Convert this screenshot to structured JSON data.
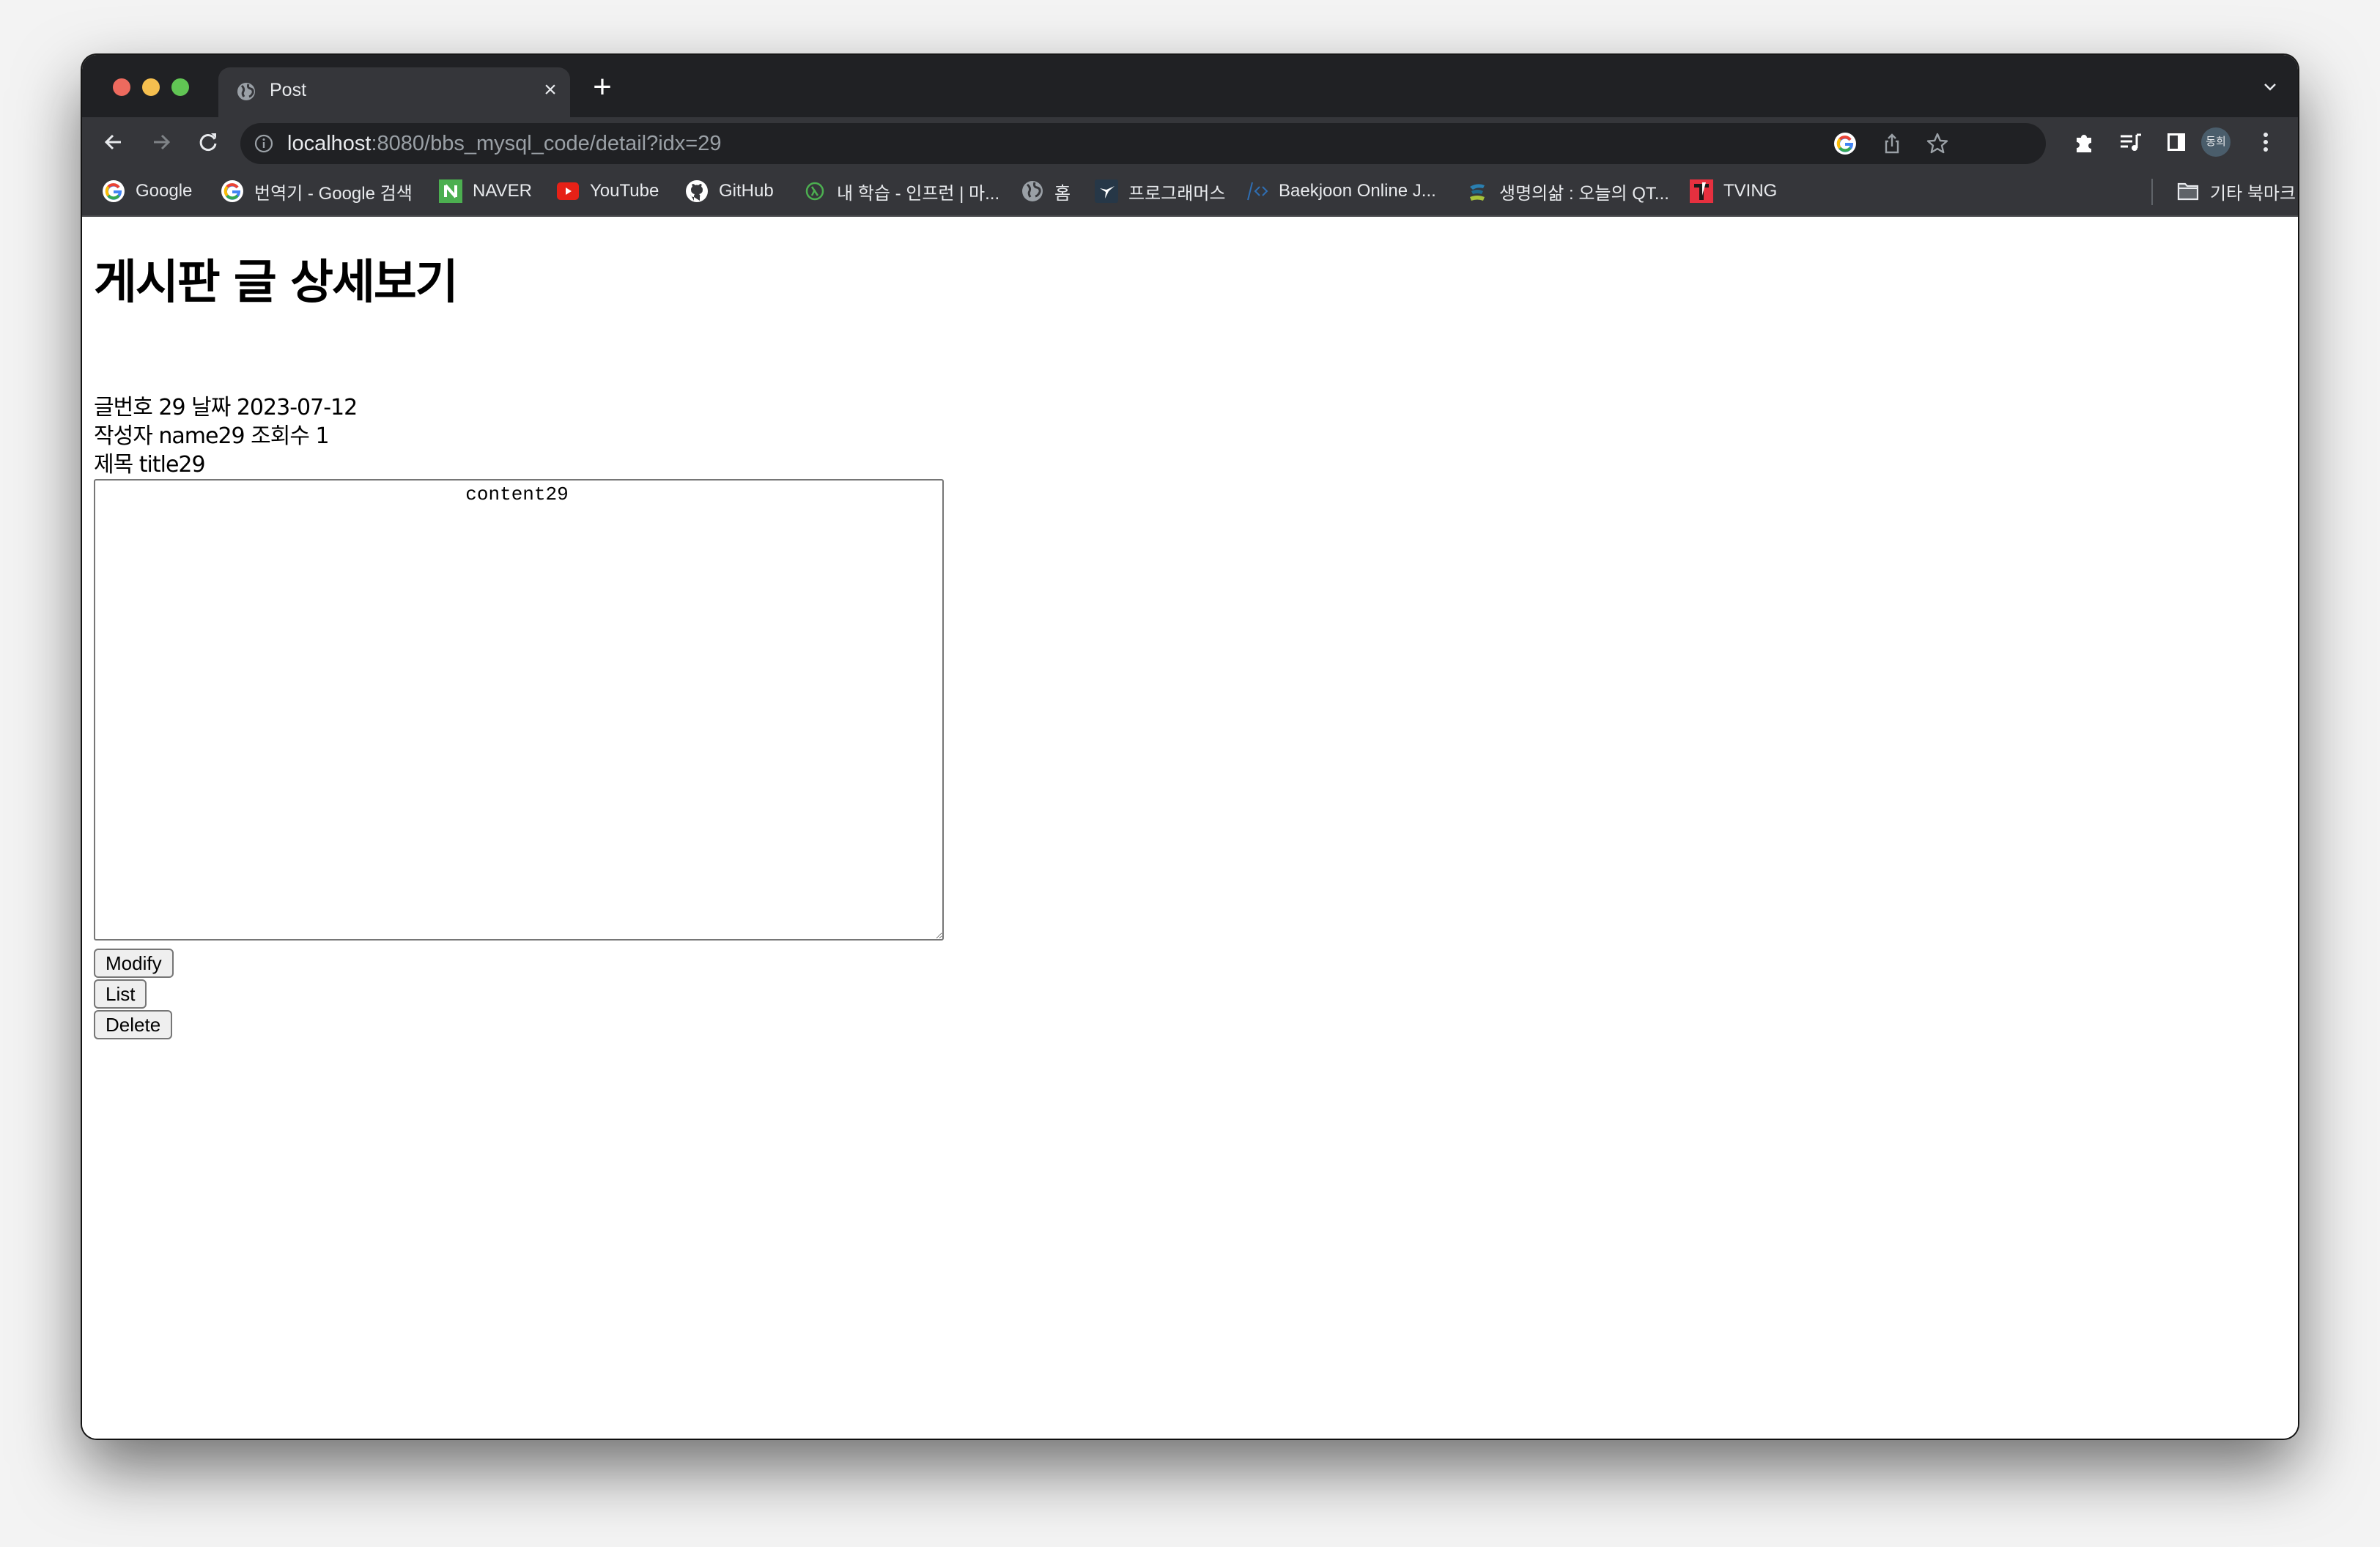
{
  "browser": {
    "tab": {
      "title": "Post",
      "favicon": "globe-icon"
    },
    "toolbar": {
      "url_host": "localhost",
      "url_rest": ":8080/bbs_mysql_code/detail?idx=29",
      "icons": [
        "back-icon",
        "forward-icon",
        "reload-icon",
        "info-icon",
        "google-lens-icon",
        "share-icon",
        "bookmark-star-icon",
        "extensions-icon",
        "media-control-icon",
        "side-panel-icon",
        "profile-avatar",
        "menu-icon"
      ],
      "profile_label": "동희"
    },
    "bookmarks": [
      {
        "label": "Google",
        "icon": "google-icon"
      },
      {
        "label": "번역기 - Google 검색",
        "icon": "google-icon"
      },
      {
        "label": "NAVER",
        "icon": "naver-icon"
      },
      {
        "label": "YouTube",
        "icon": "youtube-icon"
      },
      {
        "label": "GitHub",
        "icon": "github-icon"
      },
      {
        "label": "내 학습 - 인프런 | 마...",
        "icon": "inflearn-icon"
      },
      {
        "label": "홈",
        "icon": "globe-icon"
      },
      {
        "label": "프로그래머스",
        "icon": "programmers-icon"
      },
      {
        "label": "Baekjoon Online J...",
        "icon": "baekjoon-icon"
      },
      {
        "label": "생명의삶 : 오늘의 QT...",
        "icon": "qt-icon"
      },
      {
        "label": "TVING",
        "icon": "tving-icon"
      }
    ],
    "other_bookmarks": "기타 북마크"
  },
  "page": {
    "heading": "게시판 글 상세보기",
    "info": {
      "idx_label": "글번호",
      "idx": "29",
      "date_label": "날짜",
      "date": "2023-07-12",
      "writer_label": "작성자",
      "writer": "name29",
      "views_label": "조회수",
      "views": "1",
      "title_label": "제목",
      "title": "title29"
    },
    "content": "\t\t\t\tcontent29",
    "buttons": {
      "modify": "Modify",
      "list": "List",
      "delete": "Delete"
    }
  }
}
